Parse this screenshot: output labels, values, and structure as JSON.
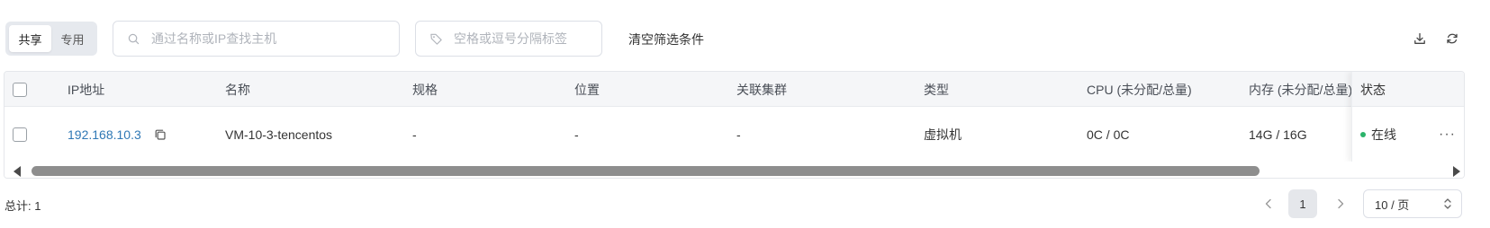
{
  "toolbar": {
    "segment": {
      "options": [
        "共享",
        "专用"
      ],
      "selected": "共享"
    },
    "search": {
      "placeholder": "通过名称或IP查找主机",
      "value": ""
    },
    "tags": {
      "placeholder": "空格或逗号分隔标签",
      "value": ""
    },
    "clear_label": "清空筛选条件",
    "icons": [
      "download-icon",
      "refresh-icon"
    ]
  },
  "table": {
    "columns": [
      "IP地址",
      "名称",
      "规格",
      "位置",
      "关联集群",
      "类型",
      "CPU (未分配/总量)",
      "内存 (未分配/总量)",
      "状态"
    ],
    "rows": [
      {
        "ip": "192.168.10.3",
        "name": "VM-10-3-tencentos",
        "spec": "-",
        "location": "-",
        "cluster": "-",
        "type": "虚拟机",
        "cpu": "0C / 0C",
        "memory": "14G / 16G",
        "status": "在线",
        "status_color": "#2bb36a",
        "actions": "···"
      }
    ]
  },
  "footer": {
    "total_label": "总计: 1",
    "current_page": "1",
    "page_size": "10 / 页"
  }
}
